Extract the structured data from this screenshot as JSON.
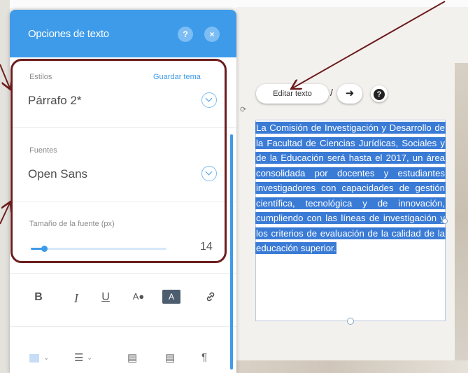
{
  "panel": {
    "title": "Opciones de texto",
    "help_icon": "?",
    "close_icon": "×",
    "styles": {
      "label": "Estilos",
      "save_link": "Guardar tema",
      "value": "Párrafo 2*"
    },
    "fonts": {
      "label": "Fuentes",
      "value": "Open Sans"
    },
    "font_size": {
      "label": "Tamaño de la fuente (px)",
      "value": "14",
      "slider_fraction": 0.1
    },
    "toolbar": {
      "bold": "B",
      "italic": "I",
      "underline": "U",
      "text_color": "A",
      "highlight": "A",
      "link_icon": "link-icon"
    },
    "toolbar2": {
      "align_icon": "align-left-icon",
      "list_icon": "bullet-list-icon",
      "indent_icon": "indent-icon",
      "outdent_icon": "outdent-icon",
      "direction_icon": "text-direction-icon"
    },
    "accent_color": "#3d9bea",
    "annotation_color": "#6b1d1d"
  },
  "canvas": {
    "edit_button": "Editar texto",
    "arrow_icon": "animation-arrow-icon",
    "help_icon": "?",
    "text": "La Comisión de Investigación y Desarrollo de la Facultad de Ciencias Jurídicas, Sociales y de la Educación será hasta el 2017, un área consolidada por docentes y estudiantes investigadores con capacidades de gestión científica, tecnológica y de innovación, cumpliendo con las líneas de investigación y los criterios de evaluación de la calidad de la educación superior.",
    "selection_color": "#3a7bd6"
  }
}
